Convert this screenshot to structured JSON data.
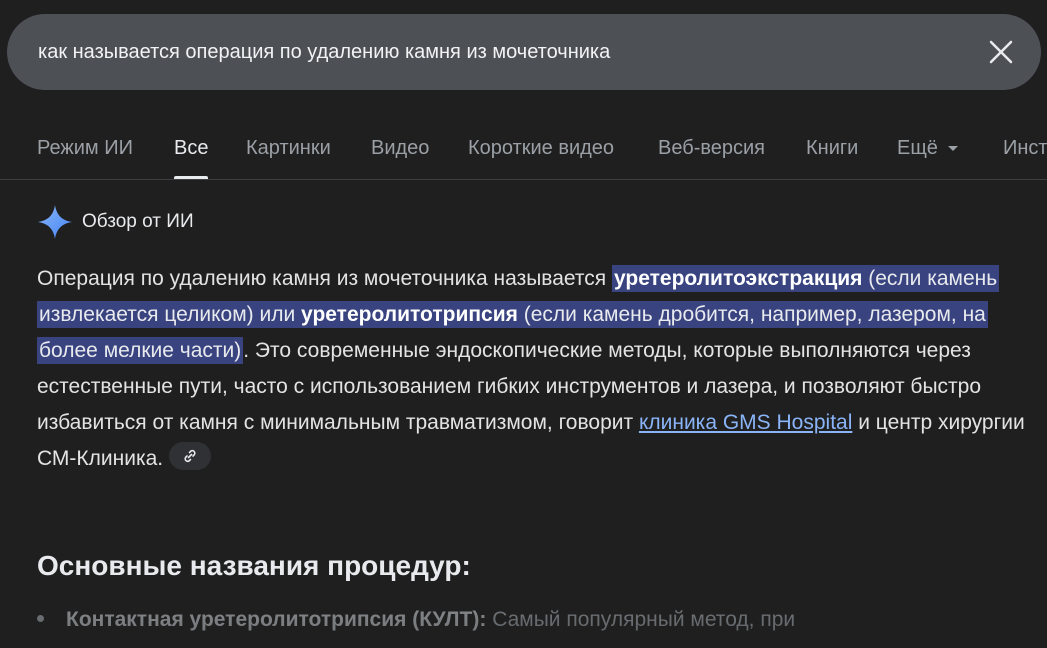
{
  "search": {
    "query": "как называется операция по удалению камня из мочеточника",
    "clear_icon": "close-icon"
  },
  "tabs": [
    {
      "label": "Режим ИИ",
      "active": false
    },
    {
      "label": "Все",
      "active": true
    },
    {
      "label": "Картинки",
      "active": false
    },
    {
      "label": "Видео",
      "active": false
    },
    {
      "label": "Короткие видео",
      "active": false
    },
    {
      "label": "Веб-версия",
      "active": false
    },
    {
      "label": "Книги",
      "active": false
    },
    {
      "label": "Ещё",
      "active": false,
      "has_dropdown": true
    },
    {
      "label": "Инст",
      "active": false
    }
  ],
  "ai_overview": {
    "icon": "sparkle-icon",
    "label": "Обзор от ИИ",
    "answer": {
      "p1": "Операция по удалению камня из мочеточника называется ",
      "term1": "уретеролитоэкстракция",
      "p2": " (если камень извлекается целиком) или ",
      "term2": "уретеролитотрипсия",
      "p3": " (если камень дробится, например, лазером, на более мелкие части)",
      "p4": ". Это современные эндоскопические методы, которые выполняются через естественные пути, часто с использованием гибких инструментов и лазера, и позволяют быстро избавиться от камня с минимальным травматизмом, говорит ",
      "link": "клиника GMS Hospital",
      "p5": " и центр хирургии СМ-Клиника.",
      "link_chip_icon": "link-icon"
    },
    "section_title": "Основные названия процедур:",
    "items": [
      {
        "term": "Контактная уретеролитотрипсия (КУЛТ):",
        "text": " Самый популярный метод, при"
      }
    ]
  },
  "colors": {
    "background": "#1f1f1f",
    "search_bar": "#4d5156",
    "highlight": "#384380",
    "link": "#8ab4f8"
  }
}
